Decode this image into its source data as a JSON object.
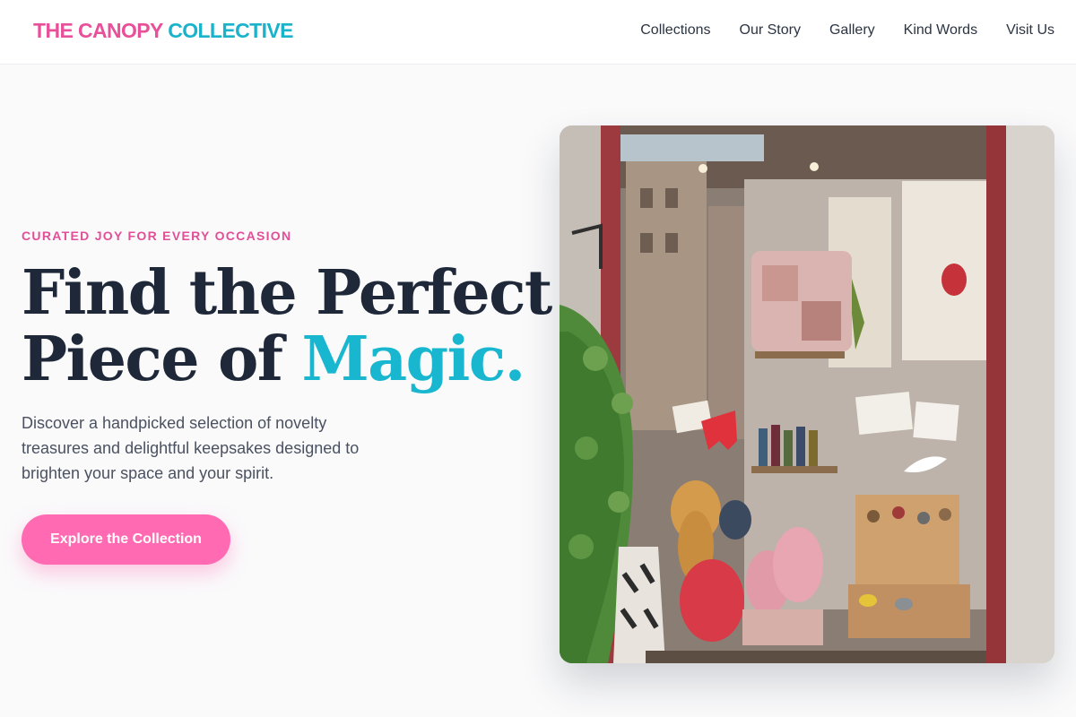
{
  "brand": {
    "name_part1": "THE CANOPY",
    "name_part2": "COLLECTIVE",
    "primary_color": "#e8509a",
    "secondary_color": "#1ab3cb"
  },
  "nav": {
    "items": [
      {
        "label": "Collections"
      },
      {
        "label": "Our Story"
      },
      {
        "label": "Gallery"
      },
      {
        "label": "Kind Words"
      },
      {
        "label": "Visit Us"
      }
    ]
  },
  "hero": {
    "eyebrow": "CURATED JOY FOR EVERY OCCASION",
    "headline_line1": "Find the Perfect",
    "headline_line2_prefix": "Piece of",
    "headline_accent": "Magic.",
    "description": "Discover a handpicked selection of novelty treasures and delightful keepsakes designed to brighten your space and your spirit.",
    "cta_label": "Explore the Collection",
    "cta_color": "#ff6ab3",
    "accent_color": "#18b7cf",
    "image_icon": "shop-window-photo"
  }
}
